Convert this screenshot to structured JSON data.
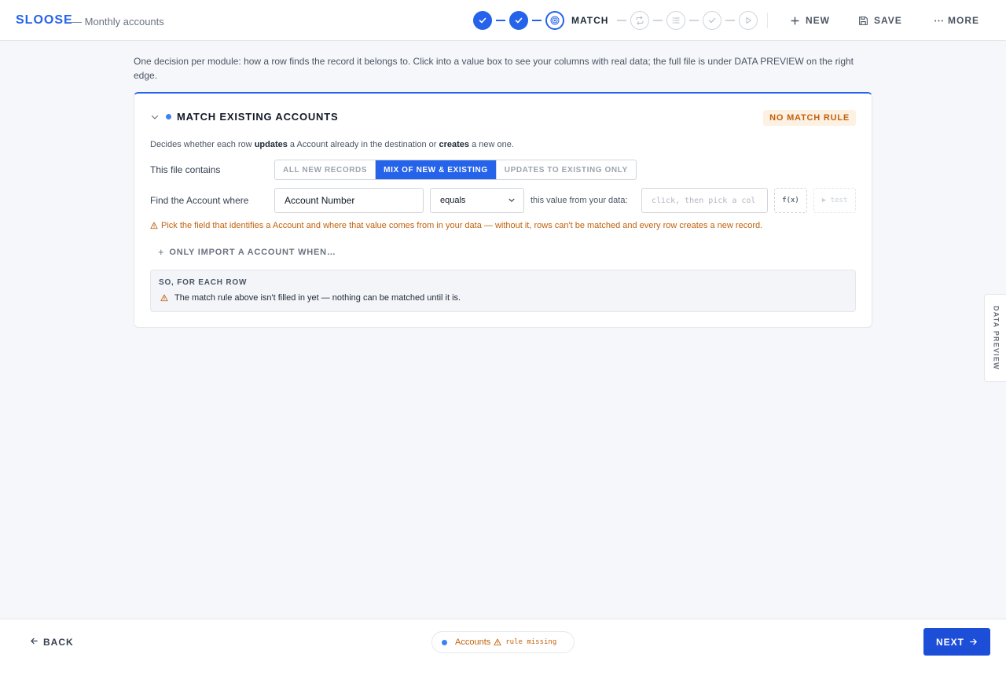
{
  "header": {
    "brand": "SLOOSE",
    "subtitle": "— Monthly accounts",
    "current_step_label": "MATCH",
    "actions": {
      "new_label": "NEW",
      "save_label": "SAVE",
      "more_label": "MORE"
    }
  },
  "stepper": {
    "steps": [
      {
        "state": "done",
        "icon": "check-icon"
      },
      {
        "state": "done",
        "icon": "check-icon"
      },
      {
        "state": "current",
        "icon": "target-icon",
        "label": "MATCH"
      },
      {
        "state": "pending",
        "icon": "repeat-icon"
      },
      {
        "state": "pending",
        "icon": "list-icon"
      },
      {
        "state": "pending",
        "icon": "check-icon"
      },
      {
        "state": "pending",
        "icon": "play-icon"
      }
    ]
  },
  "intro": "One decision per module: how a row finds the record it belongs to. Click into a value box to see your columns with real data; the full file is under DATA PREVIEW on the right edge.",
  "card": {
    "title": "MATCH EXISTING ACCOUNTS",
    "badge": "NO MATCH RULE",
    "desc": {
      "part1": "Decides whether each row ",
      "bold1": "updates",
      "part2": " a Account already in the destination or ",
      "bold2": "creates",
      "part3": " a new one."
    },
    "file_contains_label": "This file contains",
    "file_contains_options": [
      "ALL NEW RECORDS",
      "MIX OF NEW & EXISTING",
      "UPDATES TO EXISTING ONLY"
    ],
    "file_contains_selected": "MIX OF NEW & EXISTING",
    "find_label": "Find the Account where",
    "field_value": "Account Number",
    "operator_value": "equals",
    "value_from_label": "this value from your data:",
    "value_placeholder": "click, then pick a column",
    "fx_label": "f(x)",
    "test_label": "▶ test",
    "warning": "Pick the field that identifies a Account and where that value comes from in your data — without it, rows can't be matched and every row creates a new record.",
    "add_condition_label": "ONLY IMPORT A ACCOUNT WHEN…",
    "summary": {
      "title": "SO, FOR EACH ROW",
      "text": "The match rule above isn't filled in yet — nothing can be matched until it is."
    }
  },
  "side_tab_label": "DATA PREVIEW",
  "footer": {
    "back_label": "BACK",
    "pill_name": "Accounts",
    "pill_status": "rule missing",
    "next_label": "NEXT"
  },
  "colors": {
    "accent": "#2563eb",
    "warning": "#c2610c",
    "badge_bg": "#fdf1e4"
  }
}
